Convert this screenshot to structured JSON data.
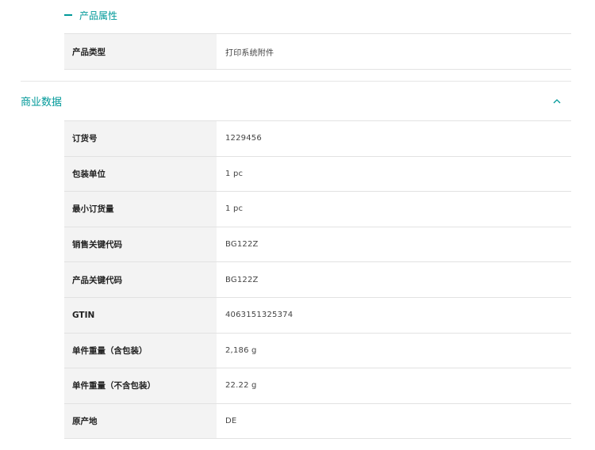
{
  "product_attributes": {
    "title": "产品属性",
    "rows": [
      {
        "label": "产品类型",
        "value": "打印系统附件"
      }
    ]
  },
  "commercial_data": {
    "title": "商业数据",
    "rows": [
      {
        "label": "订货号",
        "value": "1229456"
      },
      {
        "label": "包装单位",
        "value": "1 pc"
      },
      {
        "label": "最小订货量",
        "value": "1 pc"
      },
      {
        "label": "销售关键代码",
        "value": "BG122Z"
      },
      {
        "label": "产品关键代码",
        "value": "BG122Z"
      },
      {
        "label": "GTIN",
        "value": "4063151325374"
      },
      {
        "label": "单件重量（含包装）",
        "value": "2,186 g"
      },
      {
        "label": "单件重量（不含包装）",
        "value": "22.22 g"
      },
      {
        "label": "原产地",
        "value": "DE"
      }
    ]
  },
  "icons": {
    "collapse_subsection": "minus-icon",
    "collapse_section": "chevron-up-icon"
  },
  "colors": {
    "accent": "#009999",
    "label_bg": "#f3f3f3",
    "border": "#e2e2e2"
  }
}
